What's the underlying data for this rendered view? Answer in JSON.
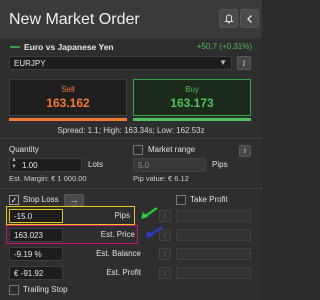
{
  "header": {
    "title": "New Market Order",
    "notify_icon": "bell-icon",
    "back_icon": "chevron-left-icon"
  },
  "instrument": {
    "name": "Euro vs Japanese Yen",
    "change": "+50.7 (+0.31%)",
    "symbol": "EURJPY"
  },
  "sell": {
    "label": "Sell",
    "price": "163.162"
  },
  "buy": {
    "label": "Buy",
    "price": "163.173"
  },
  "spread_text": "Spread: 1.1; High: 163.34s; Low: 162.53z",
  "quantity": {
    "label": "Quantity",
    "value": "1.00",
    "unit": "Lots",
    "margin": "Est. Margin: € 1 000.00"
  },
  "market_range": {
    "label": "Market range",
    "value": "5.0",
    "unit": "Pips",
    "pip_value": "Pip value: € 6.12"
  },
  "stop_loss": {
    "label": "Stop Loss",
    "rows": [
      {
        "value": "-15.0",
        "label": "Pips"
      },
      {
        "value": "163.023",
        "label": "Est. Price"
      },
      {
        "value": "-9.19 %",
        "label": "Est. Balance"
      },
      {
        "value": "€ -91.92",
        "label": "Est. Profit"
      }
    ]
  },
  "take_profit": {
    "label": "Take Profit"
  },
  "trailing_stop": {
    "label": "Trailing Stop"
  },
  "colors": {
    "sell": "#f07a36",
    "buy": "#4fc25a",
    "highlight_yellow": "#e6c619",
    "highlight_magenta": "#c4177a",
    "annot_green": "#2bd43a",
    "annot_blue": "#2a3bd8"
  }
}
